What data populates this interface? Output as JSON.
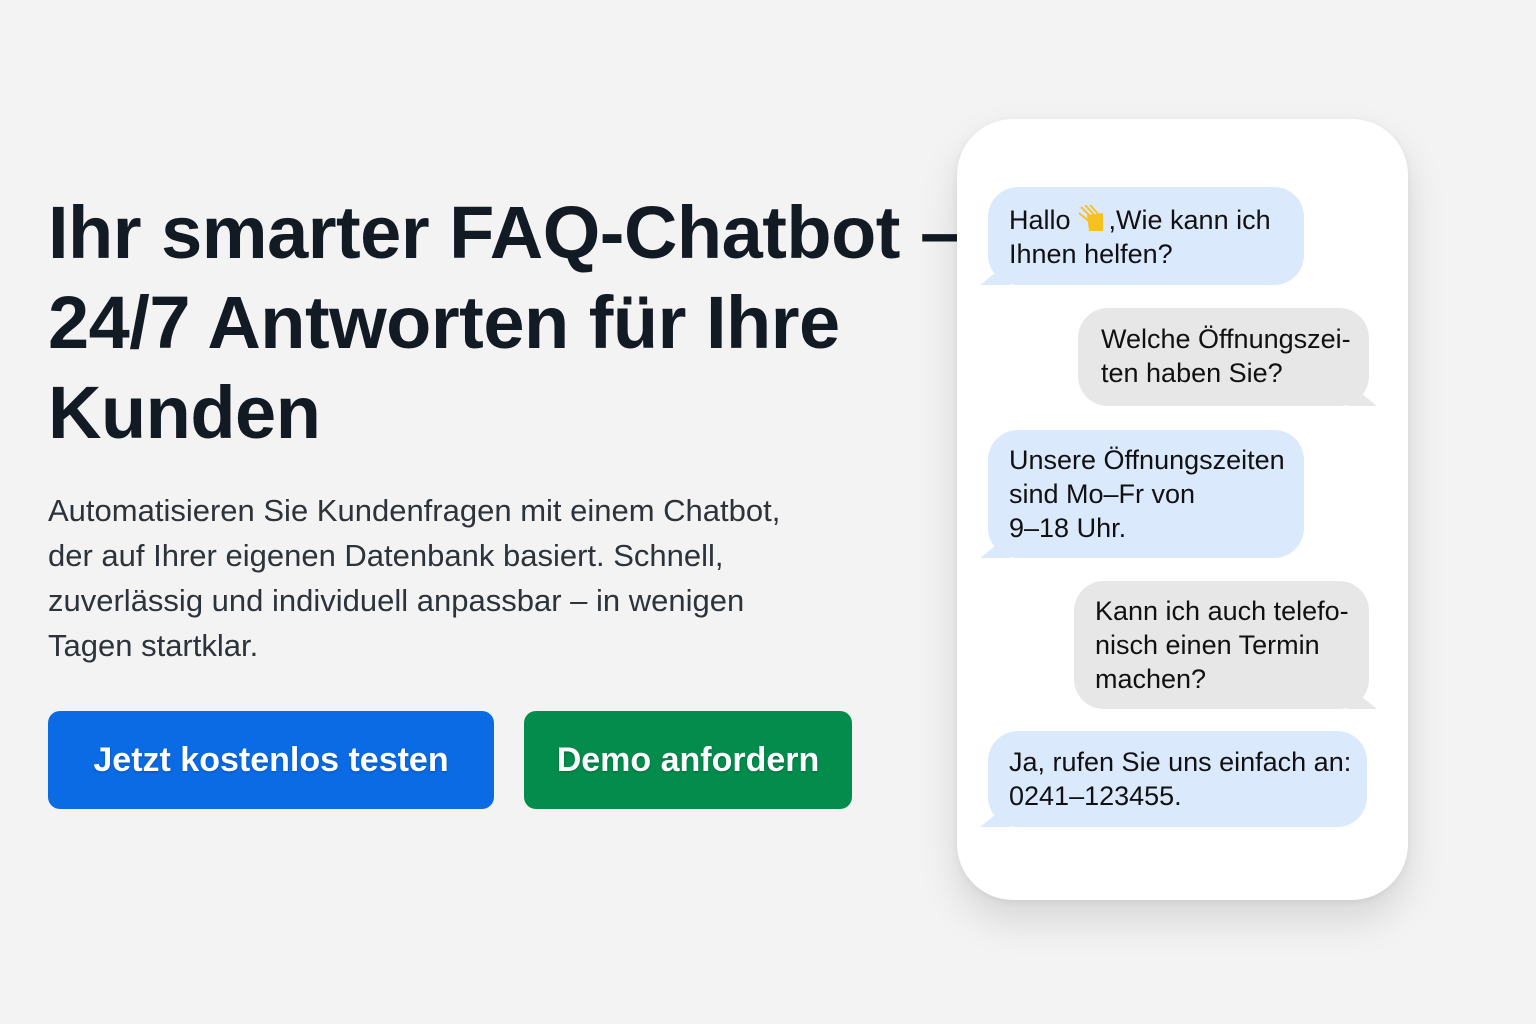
{
  "hero": {
    "headline_lines": [
      "Ihr smarter FAQ-Chatbot –",
      "24/7 Antworten für Ihre",
      "Kunden"
    ],
    "lead_lines": [
      "Automatisieren Sie Kundenfragen mit einem Chatbot,",
      "der auf Ihrer eigenen Datenbank basiert. Schnell,",
      "zuverlässig und individuell anpassbar – in wenigen",
      "Tagen startklar."
    ],
    "primary_button": "Jetzt kostenlos testen",
    "secondary_button": "Demo anfordern"
  },
  "colors": {
    "primary": "#0a6be4",
    "secondary": "#038c4c",
    "bot_bubble": "#dbe9fd",
    "user_bubble": "#e7e7e7"
  },
  "chat": {
    "messages": [
      {
        "from": "bot",
        "lines": [
          "Hallo",
          ",Wie kann ich",
          "Ihnen helfen?"
        ],
        "icon": "waving-hand-emoji"
      },
      {
        "from": "user",
        "lines": [
          "Welche Öffnungszei-",
          "ten haben Sie?"
        ]
      },
      {
        "from": "bot",
        "lines": [
          "Unsere Öffnungszeiten",
          "sind Mo–Fr von",
          "9–18 Uhr."
        ]
      },
      {
        "from": "user",
        "lines": [
          "Kann ich auch telefo-",
          "nisch einen Termin",
          "machen?"
        ]
      },
      {
        "from": "bot",
        "lines": [
          "Ja, rufen Sie uns einfach an:",
          "0241–123455."
        ]
      }
    ]
  }
}
